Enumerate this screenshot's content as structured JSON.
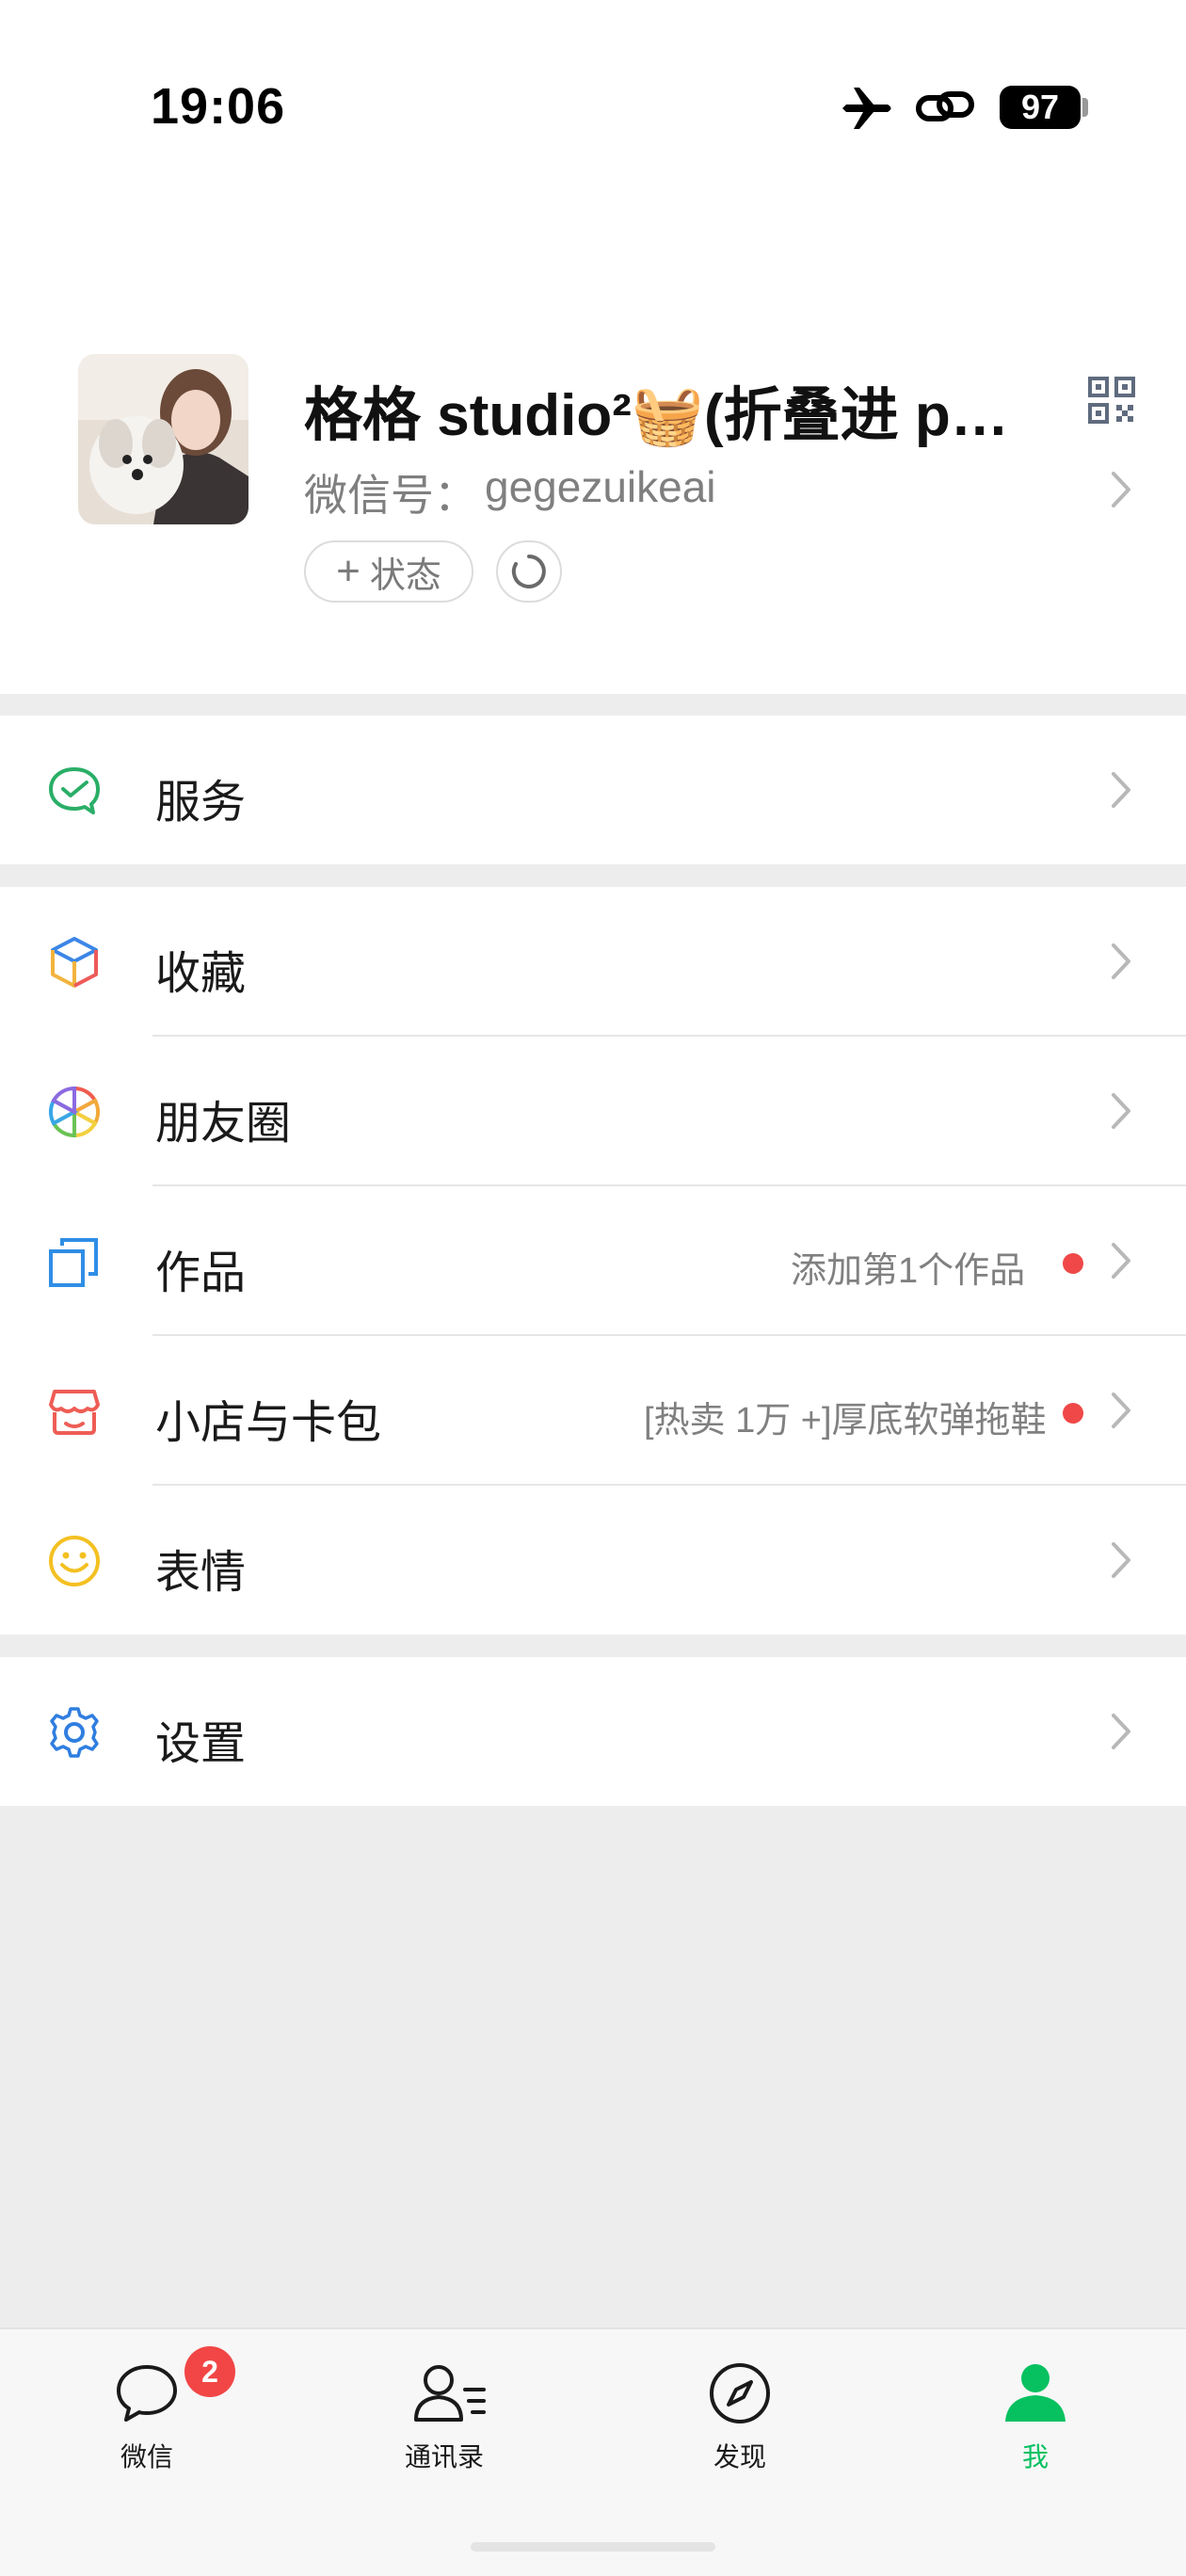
{
  "status_bar": {
    "time": "19:06",
    "battery": "97"
  },
  "profile": {
    "nickname": "格格 studio²🧺(折叠进 pyq…",
    "wechat_id_label": "微信号：",
    "wechat_id": "gegezuikeai",
    "status_button_label": "状态"
  },
  "menu": {
    "services": "服务",
    "favorites": "收藏",
    "moments": "朋友圈",
    "works": "作品",
    "works_sub": "添加第1个作品",
    "shop": "小店与卡包",
    "shop_sub": "[热卖 1万 +]厚底软弹拖鞋",
    "stickers": "表情",
    "settings": "设置"
  },
  "tabs": [
    {
      "label": "微信",
      "badge": "2"
    },
    {
      "label": "通讯录"
    },
    {
      "label": "发现"
    },
    {
      "label": "我"
    }
  ],
  "colors": {
    "accent": "#07c160",
    "badge": "#f24646",
    "background": "#ededed"
  }
}
